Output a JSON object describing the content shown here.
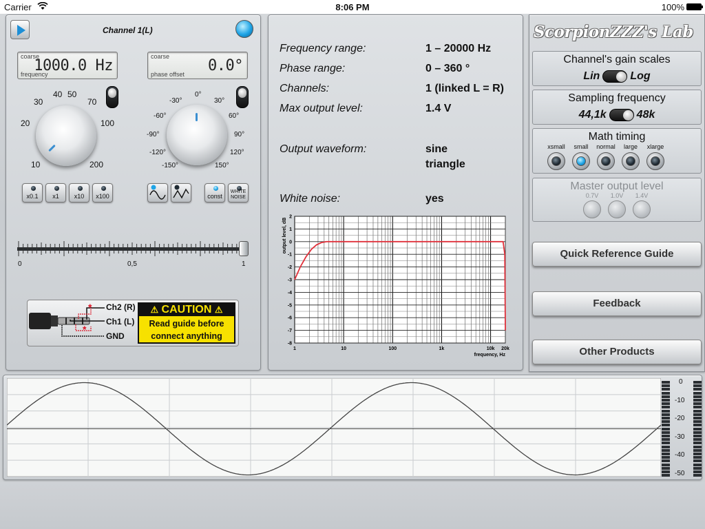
{
  "status": {
    "carrier": "Carrier",
    "time": "8:06 PM",
    "battery": "100%"
  },
  "channel": {
    "title": "Channel 1(L)",
    "freq_display": {
      "label_top": "coarse",
      "label_bottom": "frequency",
      "value": "1000.0 Hz"
    },
    "phase_display": {
      "label_top": "coarse",
      "label_bottom": "phase offset",
      "value": "0.0°"
    },
    "freq_knob_ticks": [
      "10",
      "20",
      "30",
      "40",
      "50",
      "70",
      "100",
      "200"
    ],
    "phase_knob_ticks": [
      "-150°",
      "-120°",
      "-90°",
      "-60°",
      "-30°",
      "0°",
      "30°",
      "60°",
      "90°",
      "120°",
      "150°"
    ],
    "multipliers": [
      "x0.1",
      "x1",
      "x10",
      "x100"
    ],
    "waveform_buttons": [
      "sine",
      "triangle"
    ],
    "extra_buttons": [
      "const",
      "WHITE NOISE"
    ],
    "slider": {
      "min_label": "0",
      "mid_label": "0,5",
      "max_label": "1",
      "value": 1.0
    },
    "caution": {
      "ch2": "Ch2 (R)",
      "ch1": "Ch1 (L)",
      "gnd": "GND",
      "heading": "CAUTION",
      "line1": "Read guide before",
      "line2": "connect anything"
    }
  },
  "info": {
    "rows": [
      {
        "label": "Frequency range:",
        "value": "1 – 20000 Hz"
      },
      {
        "label": "Phase range:",
        "value": "0 – 360 °"
      },
      {
        "label": "Channels:",
        "value": "1 (linked L = R)"
      },
      {
        "label": "Max output level:",
        "value": "1.4 V"
      }
    ],
    "waveform_label": "Output waveform:",
    "waveform_values": [
      "sine",
      "triangle"
    ],
    "noise_label": "White noise:",
    "noise_value": "yes"
  },
  "chart_data": {
    "type": "line",
    "title": "",
    "xlabel": "frequency, Hz",
    "ylabel": "output level, dB",
    "xscale": "log",
    "xlim": [
      1,
      20000
    ],
    "ylim": [
      -8,
      2
    ],
    "x_ticks": [
      "1",
      "10",
      "100",
      "1k",
      "10k",
      "20k"
    ],
    "y_ticks": [
      "2",
      "1",
      "0",
      "-1",
      "-2",
      "-3",
      "-4",
      "-5",
      "-6",
      "-7",
      "-8"
    ],
    "series": [
      {
        "color": "#e0303a",
        "x": [
          1,
          1.3,
          1.7,
          2.2,
          2.8,
          3.5,
          4.5,
          6,
          10,
          100,
          1000,
          10000,
          18000,
          19500,
          20000
        ],
        "y": [
          -3.0,
          -2.0,
          -1.2,
          -0.6,
          -0.25,
          -0.08,
          0,
          0,
          0,
          0,
          0,
          0,
          0,
          -1.0,
          -7.0
        ]
      }
    ],
    "grid": true
  },
  "brand": "ScorpionZZZ's Lab",
  "settings": {
    "gain": {
      "title": "Channel's gain scales",
      "left": "Lin",
      "right": "Log",
      "selected": "Log"
    },
    "sampling": {
      "title": "Sampling frequency",
      "left": "44,1k",
      "right": "48k",
      "selected": "48k"
    },
    "timing": {
      "title": "Math timing",
      "options": [
        "xsmall",
        "small",
        "normal",
        "large",
        "xlarge"
      ],
      "selected": "small"
    },
    "master": {
      "title": "Master output level",
      "options": [
        "0.7V",
        "1.0V",
        "1.4V"
      ],
      "disabled": true
    }
  },
  "buttons": {
    "quick_ref": "Quick Reference Guide",
    "feedback": "Feedback",
    "other": "Other Products"
  },
  "scope": {
    "vu_labels": [
      "0",
      "-10",
      "-20",
      "-30",
      "-40",
      "-50"
    ],
    "wave_cycles": 2
  }
}
